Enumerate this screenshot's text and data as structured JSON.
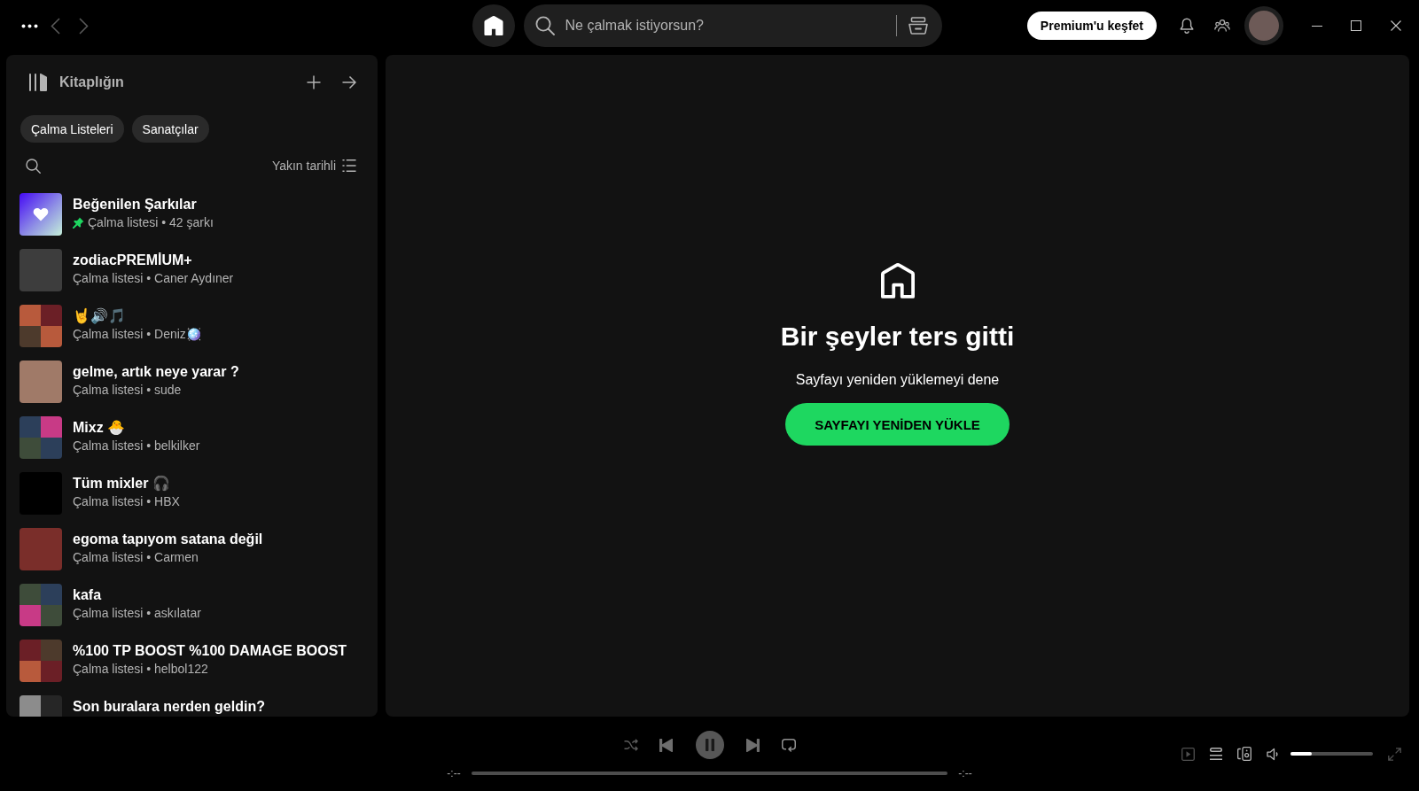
{
  "top_bar": {
    "navigation": {
      "back_disabled": true,
      "forward_disabled": true
    },
    "search": {
      "placeholder": "Ne çalmak istiyorsun?"
    },
    "premium_button": "Premium'u keşfet"
  },
  "library": {
    "title": "Kitaplığın",
    "filters": [
      {
        "label": "Çalma Listeleri",
        "selected": false
      },
      {
        "label": "Sanatçılar",
        "selected": false
      }
    ],
    "sort_label": "Yakın tarihli",
    "items": [
      {
        "kind": "liked",
        "title": "Beğenilen Şarkılar",
        "subtitle": "Çalma listesi • 42 şarkı",
        "pinned": true
      },
      {
        "kind": "photo",
        "title": "zodiacPREMİUM+",
        "subtitle": "Çalma listesi • Caner Aydıner",
        "pinned": false
      },
      {
        "kind": "mosaic",
        "title": "🤘🔊🎵",
        "subtitle": "Çalma listesi • Deniz🪩",
        "pinned": false
      },
      {
        "kind": "photo",
        "title": "gelme, artık neye yarar ?",
        "subtitle": "Çalma listesi • sude",
        "pinned": false
      },
      {
        "kind": "mosaic",
        "title": "Mixz 🐣",
        "subtitle": "Çalma listesi • belkilker",
        "pinned": false
      },
      {
        "kind": "photo",
        "title": "Tüm mixler 🎧",
        "subtitle": "Çalma listesi • HBX",
        "pinned": false
      },
      {
        "kind": "photo",
        "title": "egoma tapıyom satana değil",
        "subtitle": "Çalma listesi • Carmen",
        "pinned": false
      },
      {
        "kind": "mosaic",
        "title": "kafa",
        "subtitle": "Çalma listesi • askılatar",
        "pinned": false
      },
      {
        "kind": "mosaic",
        "title": "%100 TP BOOST %100 DAMAGE BOOST",
        "subtitle": "Çalma listesi • helbol122",
        "pinned": false
      },
      {
        "kind": "mosaic",
        "title": "Son buralara nerden geldin?",
        "pinned": false
      }
    ]
  },
  "error": {
    "title": "Bir şeyler ters gitti",
    "message": "Sayfayı yeniden yüklemeyi dene",
    "button": "SAYFAYI YENİDEN YÜKLE"
  },
  "player": {
    "controls_disabled": true,
    "elapsed": "-:--",
    "duration": "-:--",
    "progress": {
      "level": 0
    },
    "volume": {
      "level": 0.26
    }
  }
}
